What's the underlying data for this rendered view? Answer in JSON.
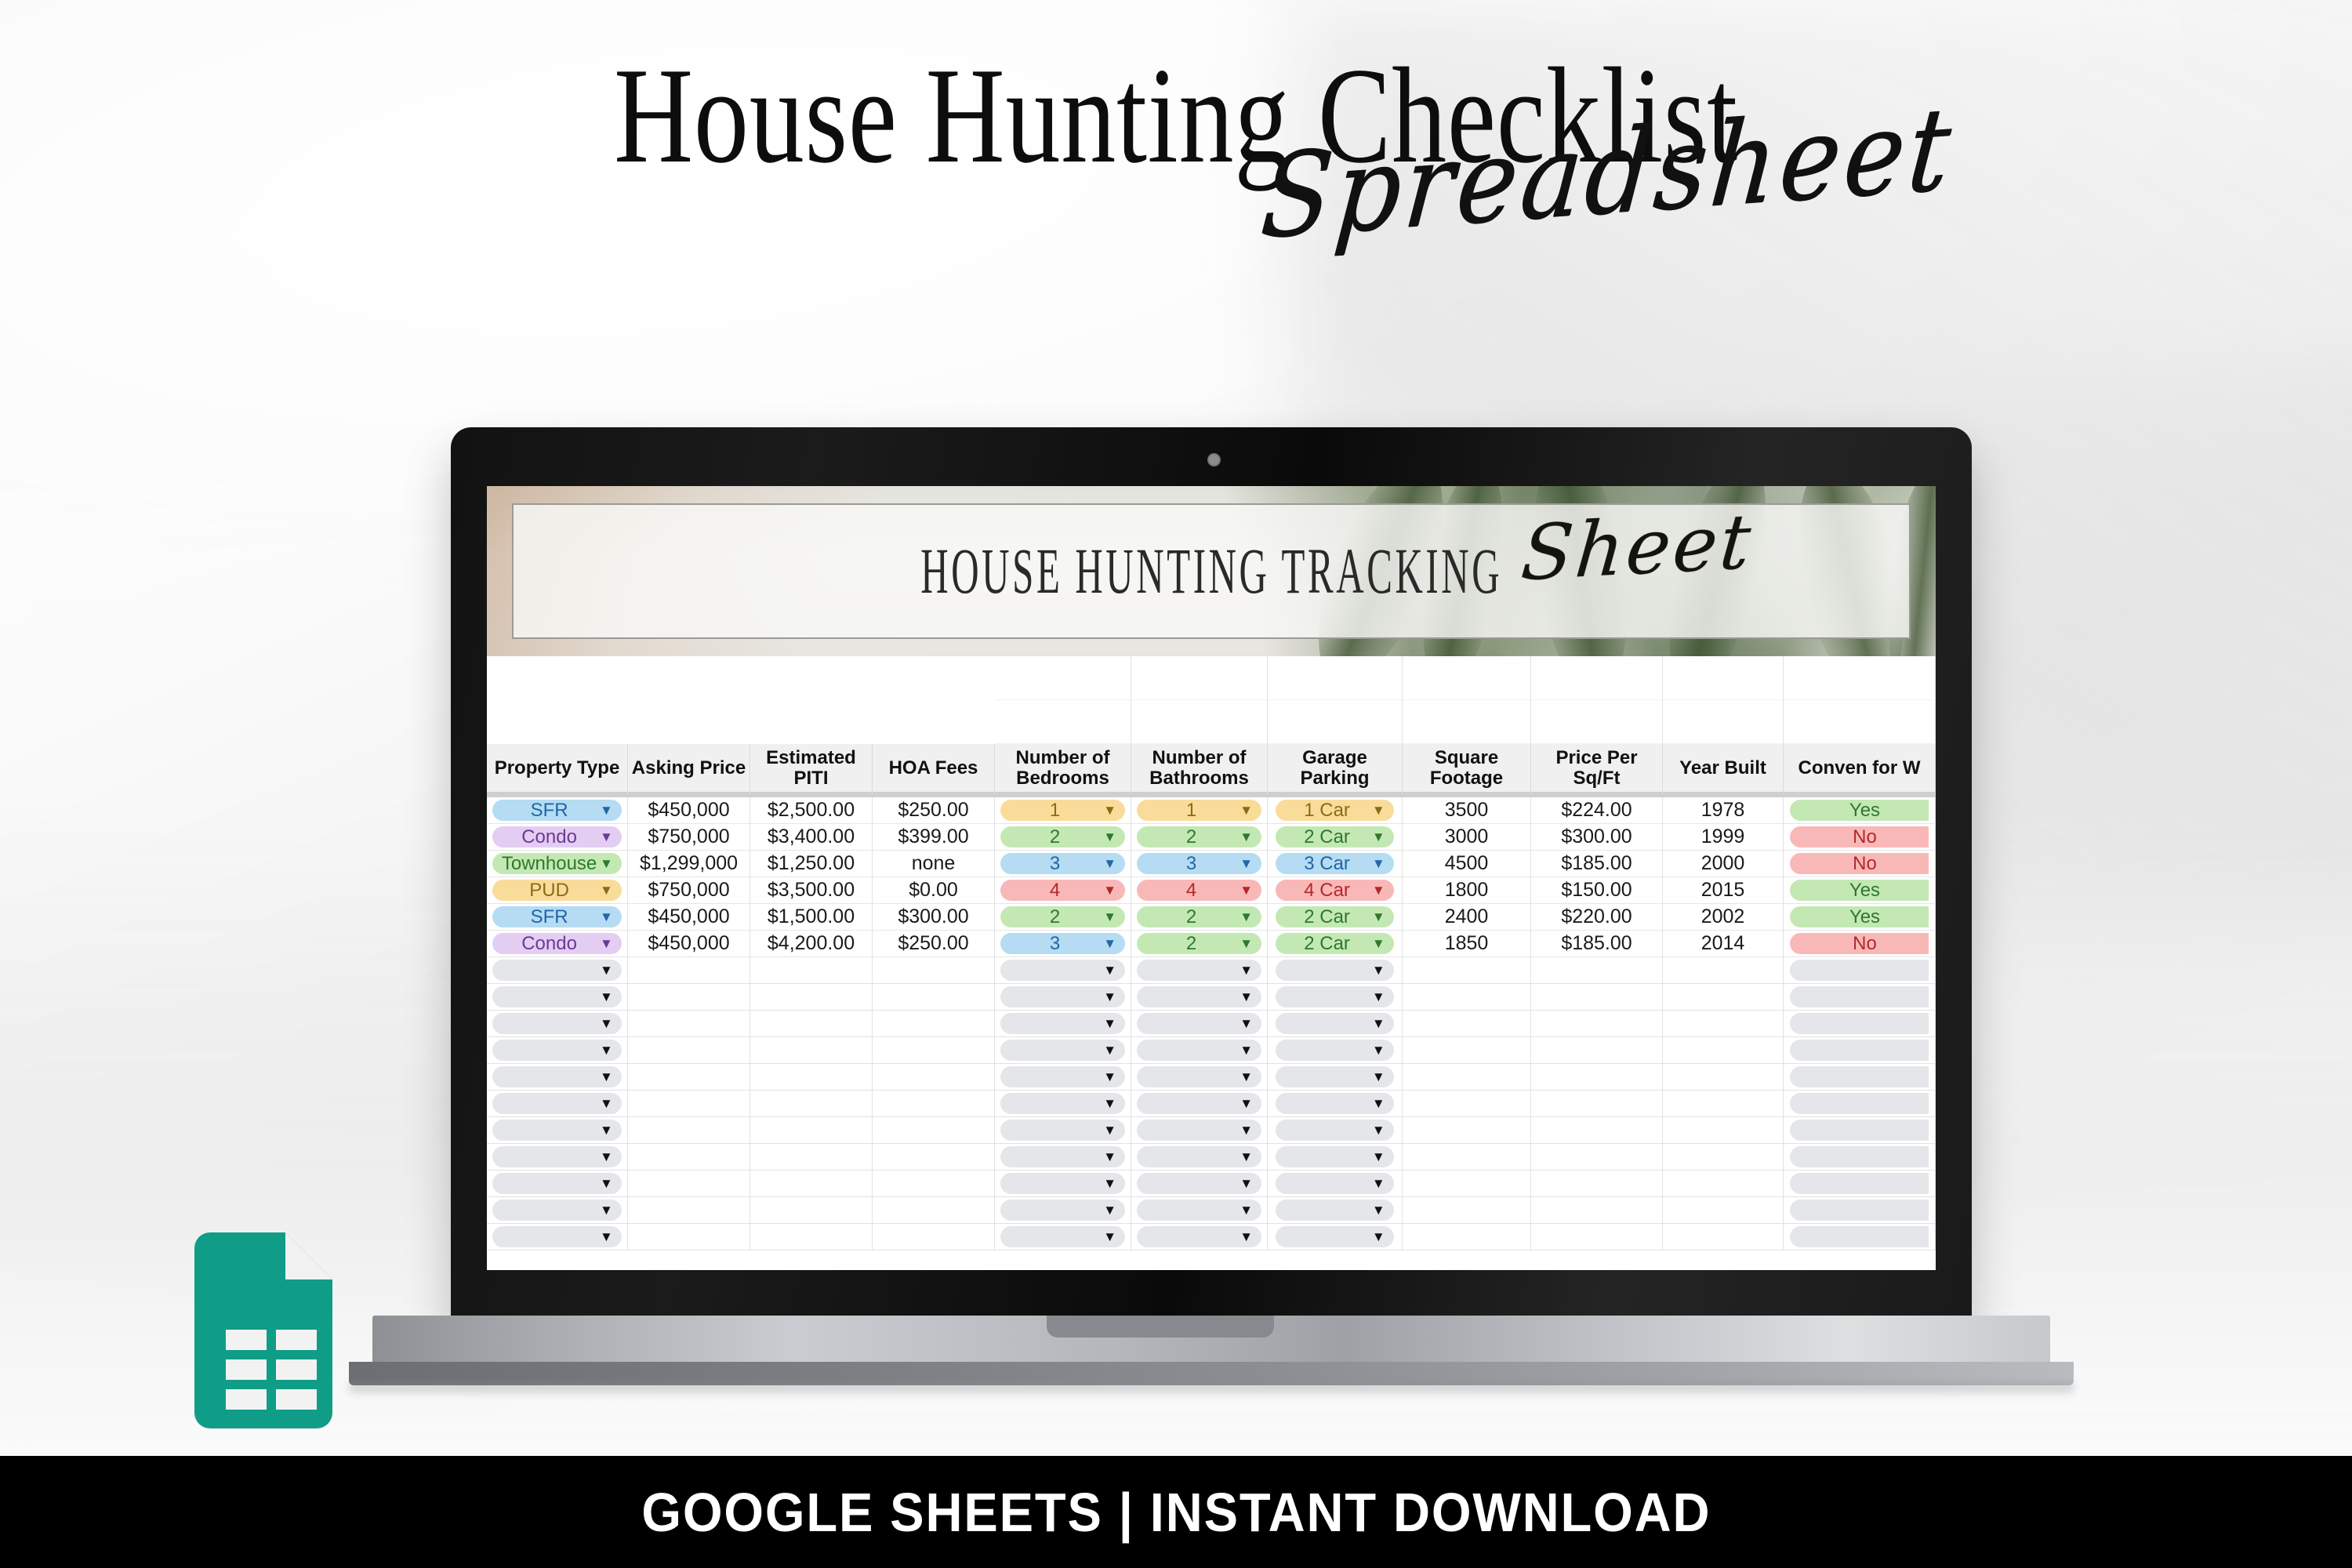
{
  "hero": {
    "title_line1": "House Hunting Checklist",
    "title_script": "Spreadsheet"
  },
  "footer": {
    "text": "GOOGLE SHEETS | INSTANT DOWNLOAD"
  },
  "sheets_icon": {
    "name": "google-sheets-icon",
    "color": "#0F9D87"
  },
  "device": {
    "type": "laptop",
    "webcam": "webcam-dot"
  },
  "sheet": {
    "banner_title": "HOUSE HUNTING TRACKING",
    "banner_script": "Sheet",
    "columns": [
      "Property Type",
      "Asking Price",
      "Estimated PITI",
      "HOA Fees",
      "Number of Bedrooms",
      "Number of Bathrooms",
      "Garage Parking",
      "Square Footage",
      "Price Per Sq/Ft",
      "Year Built",
      "Convenient for Work"
    ],
    "column_truncated_last": "Conven for W",
    "rows": [
      {
        "property_type": "SFR",
        "property_type_color": "blue",
        "asking_price": "$450,000",
        "estimated_piti": "$2,500.00",
        "hoa_fees": "$250.00",
        "bedrooms": "1",
        "bedrooms_color": "yellow",
        "bathrooms": "1",
        "bathrooms_color": "yellow",
        "garage": "1 Car",
        "garage_color": "yellow",
        "square_footage": "3500",
        "price_per_sqft": "$224.00",
        "year_built": "1978",
        "convenient": "Yes",
        "convenient_color": "green"
      },
      {
        "property_type": "Condo",
        "property_type_color": "purple",
        "asking_price": "$750,000",
        "estimated_piti": "$3,400.00",
        "hoa_fees": "$399.00",
        "bedrooms": "2",
        "bedrooms_color": "green",
        "bathrooms": "2",
        "bathrooms_color": "green",
        "garage": "2 Car",
        "garage_color": "green",
        "square_footage": "3000",
        "price_per_sqft": "$300.00",
        "year_built": "1999",
        "convenient": "No",
        "convenient_color": "red"
      },
      {
        "property_type": "Townhouse",
        "property_type_color": "green",
        "asking_price": "$1,299,000",
        "estimated_piti": "$1,250.00",
        "hoa_fees": "none",
        "bedrooms": "3",
        "bedrooms_color": "blue",
        "bathrooms": "3",
        "bathrooms_color": "blue",
        "garage": "3 Car",
        "garage_color": "blue",
        "square_footage": "4500",
        "price_per_sqft": "$185.00",
        "year_built": "2000",
        "convenient": "No",
        "convenient_color": "red"
      },
      {
        "property_type": "PUD",
        "property_type_color": "yellow",
        "asking_price": "$750,000",
        "estimated_piti": "$3,500.00",
        "hoa_fees": "$0.00",
        "bedrooms": "4",
        "bedrooms_color": "red",
        "bathrooms": "4",
        "bathrooms_color": "red",
        "garage": "4 Car",
        "garage_color": "red",
        "square_footage": "1800",
        "price_per_sqft": "$150.00",
        "year_built": "2015",
        "convenient": "Yes",
        "convenient_color": "green"
      },
      {
        "property_type": "SFR",
        "property_type_color": "blue",
        "asking_price": "$450,000",
        "estimated_piti": "$1,500.00",
        "hoa_fees": "$300.00",
        "bedrooms": "2",
        "bedrooms_color": "green",
        "bathrooms": "2",
        "bathrooms_color": "green",
        "garage": "2 Car",
        "garage_color": "green",
        "square_footage": "2400",
        "price_per_sqft": "$220.00",
        "year_built": "2002",
        "convenient": "Yes",
        "convenient_color": "green"
      },
      {
        "property_type": "Condo",
        "property_type_color": "purple",
        "asking_price": "$450,000",
        "estimated_piti": "$4,200.00",
        "hoa_fees": "$250.00",
        "bedrooms": "3",
        "bedrooms_color": "blue",
        "bathrooms": "2",
        "bathrooms_color": "green",
        "garage": "2 Car",
        "garage_color": "green",
        "square_footage": "1850",
        "price_per_sqft": "$185.00",
        "year_built": "2014",
        "convenient": "No",
        "convenient_color": "red"
      }
    ],
    "empty_row_count": 11,
    "blank_top_rows": 2,
    "dropdown_arrow": "▼"
  }
}
